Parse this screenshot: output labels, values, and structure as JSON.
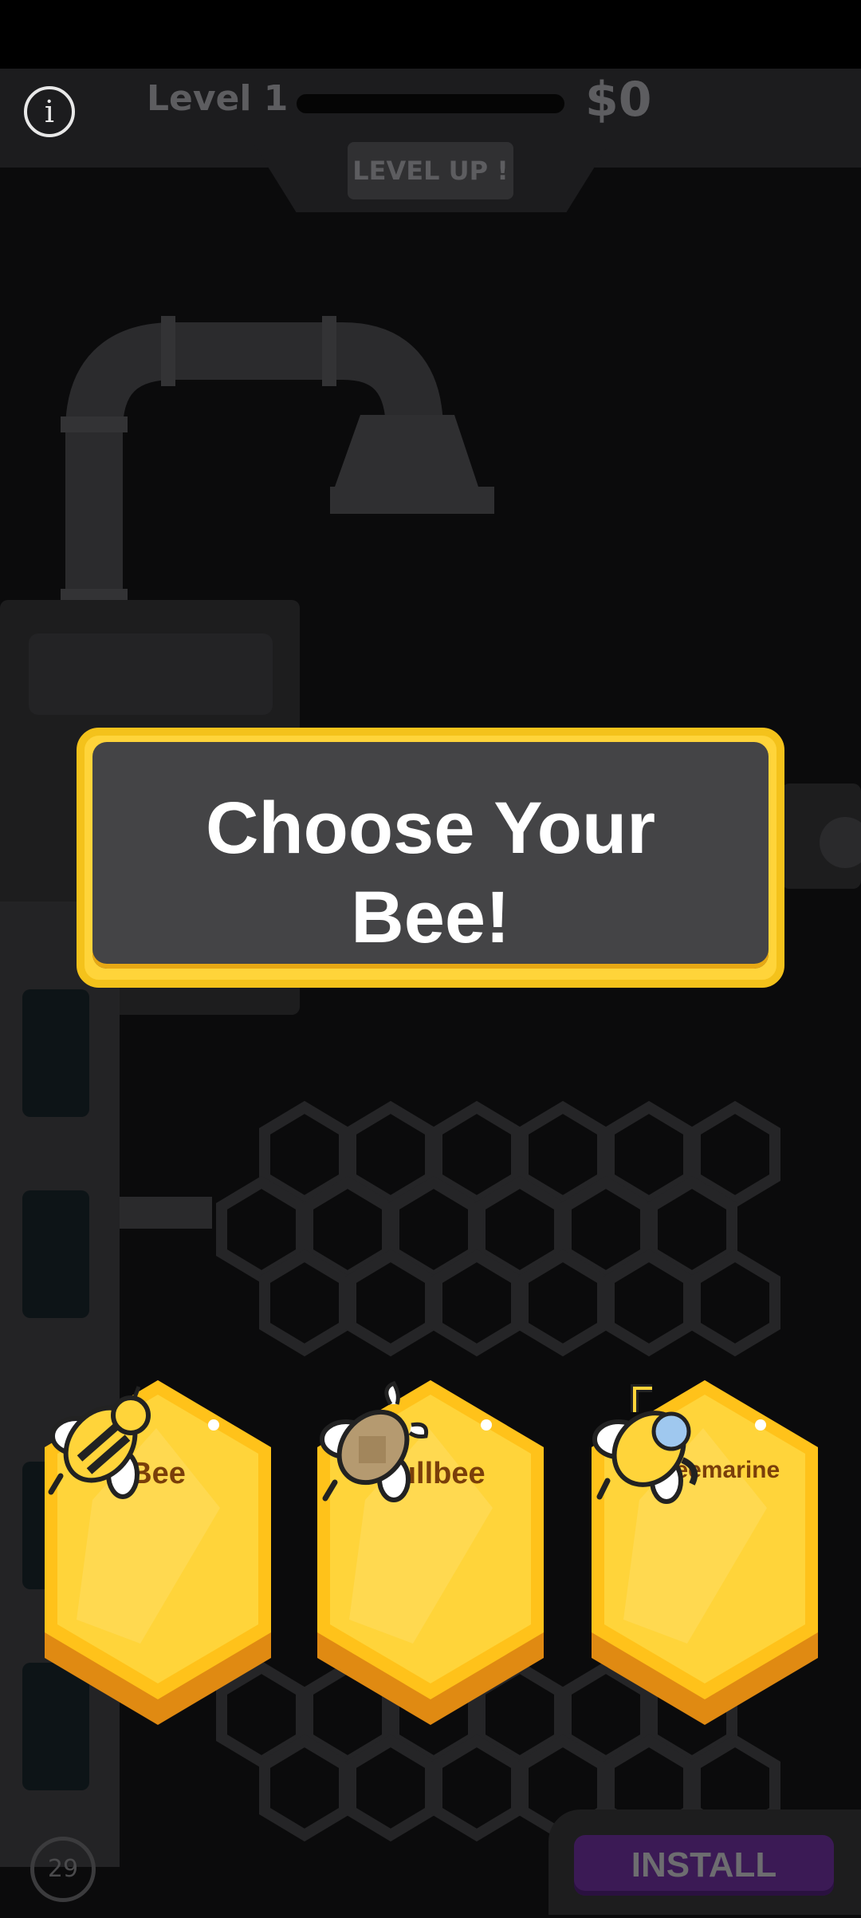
{
  "hud": {
    "info_icon": "info-icon",
    "level_label": "Level 1",
    "level_progress": 0,
    "money": "$0",
    "level_up_label": "LEVEL UP !"
  },
  "popup": {
    "title_line1": "Choose Your",
    "title_line2": "Bee!"
  },
  "cards": [
    {
      "name": "Bee",
      "icon": "bee-icon"
    },
    {
      "name": "Bullbee",
      "icon": "bullbee-icon"
    },
    {
      "name": "Subeemarine",
      "icon": "subeemarine-icon"
    }
  ],
  "footer": {
    "timer": "29",
    "install_label": "INSTALL"
  },
  "colors": {
    "accent_yellow": "#ffd43a",
    "card_orange": "#e08a12",
    "install_purple": "#3b1a55",
    "text_brown": "#7a3f0a"
  }
}
